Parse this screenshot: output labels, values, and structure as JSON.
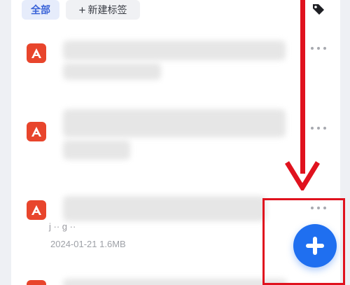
{
  "tags": {
    "all_label": "全部",
    "new_label": "新建标签",
    "new_prefix": "+"
  },
  "files": [
    {
      "icon": "pdf-icon",
      "blurred": true
    },
    {
      "icon": "pdf-icon",
      "blurred": true
    },
    {
      "icon": "pdf-icon",
      "blurred": true,
      "title_fragment": "j ·· g ··",
      "date": "2024-01-21",
      "size": "1.6MB"
    },
    {
      "icon": "pdf-icon",
      "blurred": true
    }
  ],
  "actions": {
    "more_icon": "more-dots-icon",
    "fab_icon": "plus-icon",
    "tag_icon": "tag-icon"
  },
  "annotation": {
    "arrow_color": "#e0121e",
    "box_color": "#e0121e"
  },
  "colors": {
    "accent": "#1f6ff0",
    "pdf": "#e8452c"
  }
}
